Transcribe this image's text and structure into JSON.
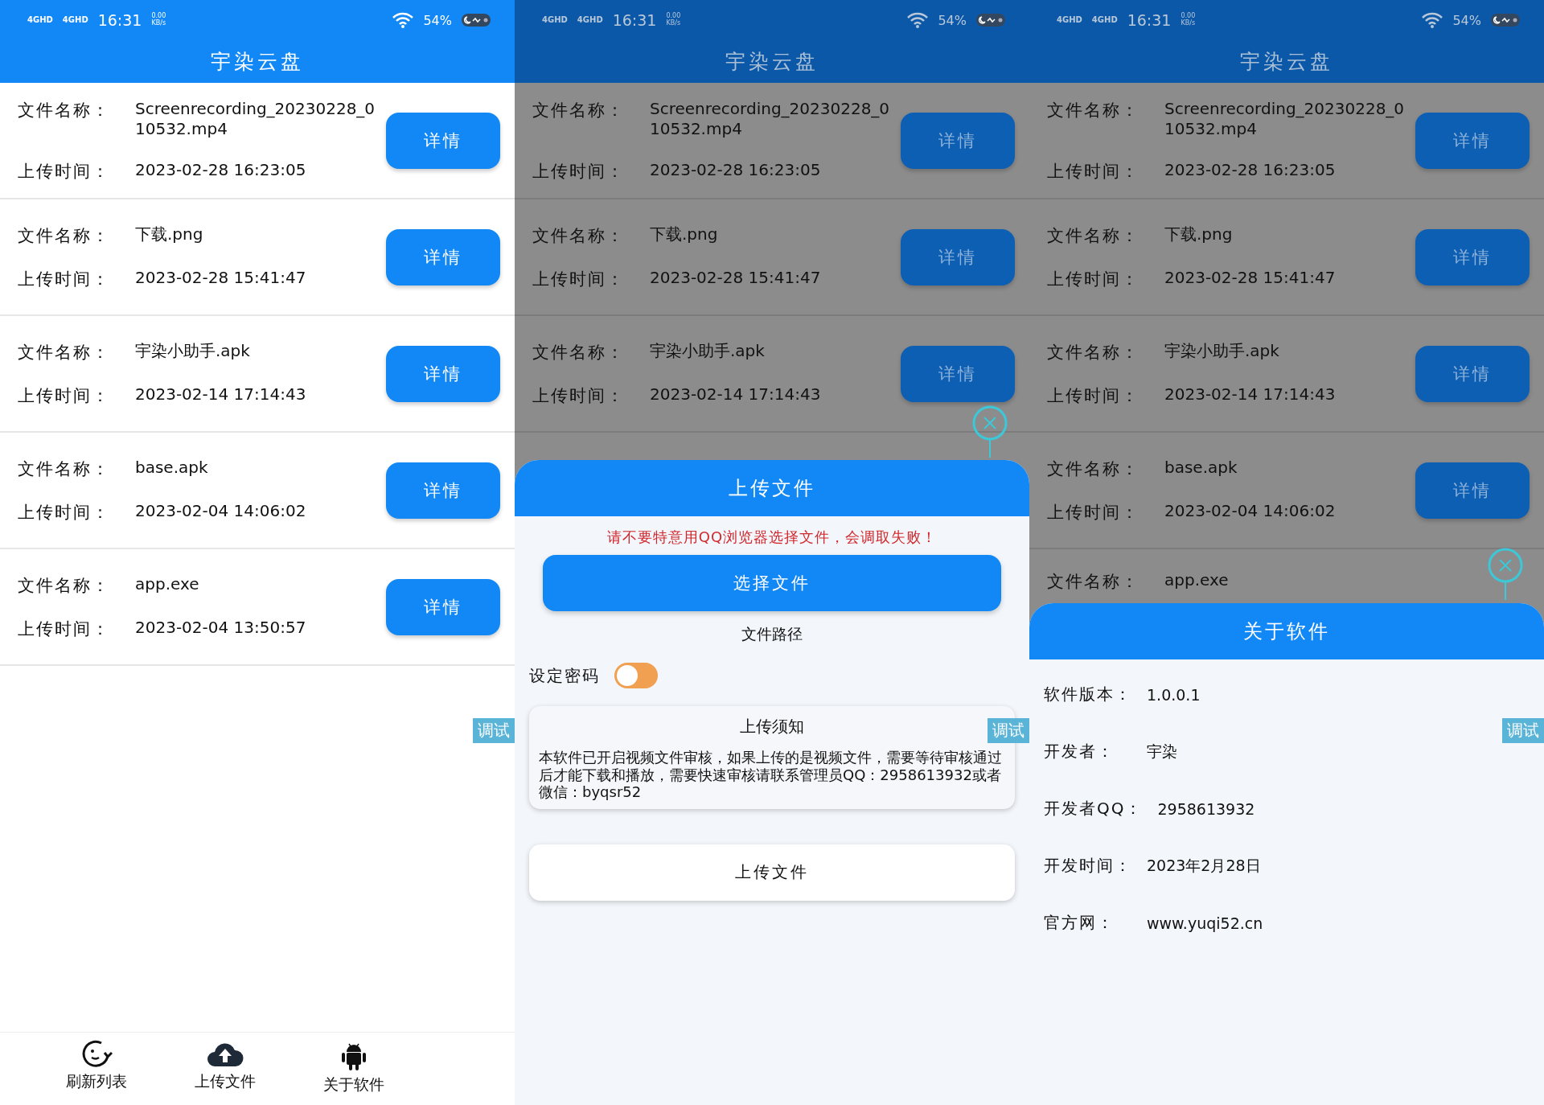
{
  "panels": [
    {
      "kind": "list",
      "status_bar": {
        "network": "4GHD",
        "network_2": "4GHD",
        "time": "16:31",
        "speed": "0.00",
        "speed_unit": "KB/s",
        "battery": "54%"
      },
      "title": "宇染云盘",
      "dimmed": false,
      "files": [
        {
          "name_label": "文件名称：",
          "name": "Screenrecording_20230228_010532.mp4",
          "time_label": "上传时间：",
          "time": "2023-02-28 16:23:05",
          "button": "详情"
        },
        {
          "name_label": "文件名称：",
          "name": "下载.png",
          "time_label": "上传时间：",
          "time": "2023-02-28 15:41:47",
          "button": "详情"
        },
        {
          "name_label": "文件名称：",
          "name": "宇染小助手.apk",
          "time_label": "上传时间：",
          "time": "2023-02-14 17:14:43",
          "button": "详情"
        },
        {
          "name_label": "文件名称：",
          "name": "base.apk",
          "time_label": "上传时间：",
          "time": "2023-02-04 14:06:02",
          "button": "详情"
        },
        {
          "name_label": "文件名称：",
          "name": "app.exe",
          "time_label": "上传时间：",
          "time": "2023-02-04 13:50:57",
          "button": "详情"
        }
      ],
      "debug_tag": "调试",
      "bottom_nav": [
        {
          "label": "刷新列表"
        },
        {
          "label": "上传文件"
        },
        {
          "label": "关于软件"
        }
      ]
    },
    {
      "kind": "upload",
      "status_bar": {
        "network": "4GHD",
        "network_2": "4GHD",
        "time": "16:31",
        "speed": "0.00",
        "speed_unit": "KB/s",
        "battery": "54%"
      },
      "title": "宇染云盘",
      "dimmed": true,
      "files": [
        {
          "name_label": "文件名称：",
          "name": "Screenrecording_20230228_010532.mp4",
          "time_label": "上传时间：",
          "time": "2023-02-28 16:23:05",
          "button": "详情"
        },
        {
          "name_label": "文件名称：",
          "name": "下载.png",
          "time_label": "上传时间：",
          "time": "2023-02-28 15:41:47",
          "button": "详情"
        },
        {
          "name_label": "文件名称：",
          "name": "宇染小助手.apk",
          "time_label": "上传时间：",
          "time": "2023-02-14 17:14:43",
          "button": "详情"
        }
      ],
      "sheet": {
        "title": "上传文件",
        "warning": "请不要特意用QQ浏览器选择文件，会调取失败！",
        "choose_button": "选择文件",
        "path": "文件路径",
        "password_label": "设定密码",
        "password_on": false,
        "notice_title": "上传须知",
        "notice": "本软件已开启视频文件审核，如果上传的是视频文件，需要等待审核通过后才能下载和播放，需要快速审核请联系管理员QQ：2958613932或者微信：byqsr52",
        "upload_button": "上传文件"
      },
      "debug_tag": "调试"
    },
    {
      "kind": "about",
      "status_bar": {
        "network": "4GHD",
        "network_2": "4GHD",
        "time": "16:31",
        "speed": "0.00",
        "speed_unit": "KB/s",
        "battery": "54%"
      },
      "title": "宇染云盘",
      "dimmed": true,
      "files": [
        {
          "name_label": "文件名称：",
          "name": "Screenrecording_20230228_010532.mp4",
          "time_label": "上传时间：",
          "time": "2023-02-28 16:23:05",
          "button": "详情"
        },
        {
          "name_label": "文件名称：",
          "name": "下载.png",
          "time_label": "上传时间：",
          "time": "2023-02-28 15:41:47",
          "button": "详情"
        },
        {
          "name_label": "文件名称：",
          "name": "宇染小助手.apk",
          "time_label": "上传时间：",
          "time": "2023-02-14 17:14:43",
          "button": "详情"
        },
        {
          "name_label": "文件名称：",
          "name": "base.apk",
          "time_label": "上传时间：",
          "time": "2023-02-04 14:06:02",
          "button": "详情"
        },
        {
          "name_label": "文件名称：",
          "name": "app.exe"
        }
      ],
      "sheet": {
        "title": "关于软件",
        "info": [
          {
            "label": "软件版本：",
            "value": "1.0.0.1"
          },
          {
            "label": "开发者：",
            "value": "宇染"
          },
          {
            "label": "开发者QQ：",
            "value": "2958613932"
          },
          {
            "label": "开发时间：",
            "value": "2023年2月28日"
          },
          {
            "label": "官方网：",
            "value": "www.yuqi52.cn"
          }
        ]
      },
      "debug_tag": "调试"
    }
  ]
}
